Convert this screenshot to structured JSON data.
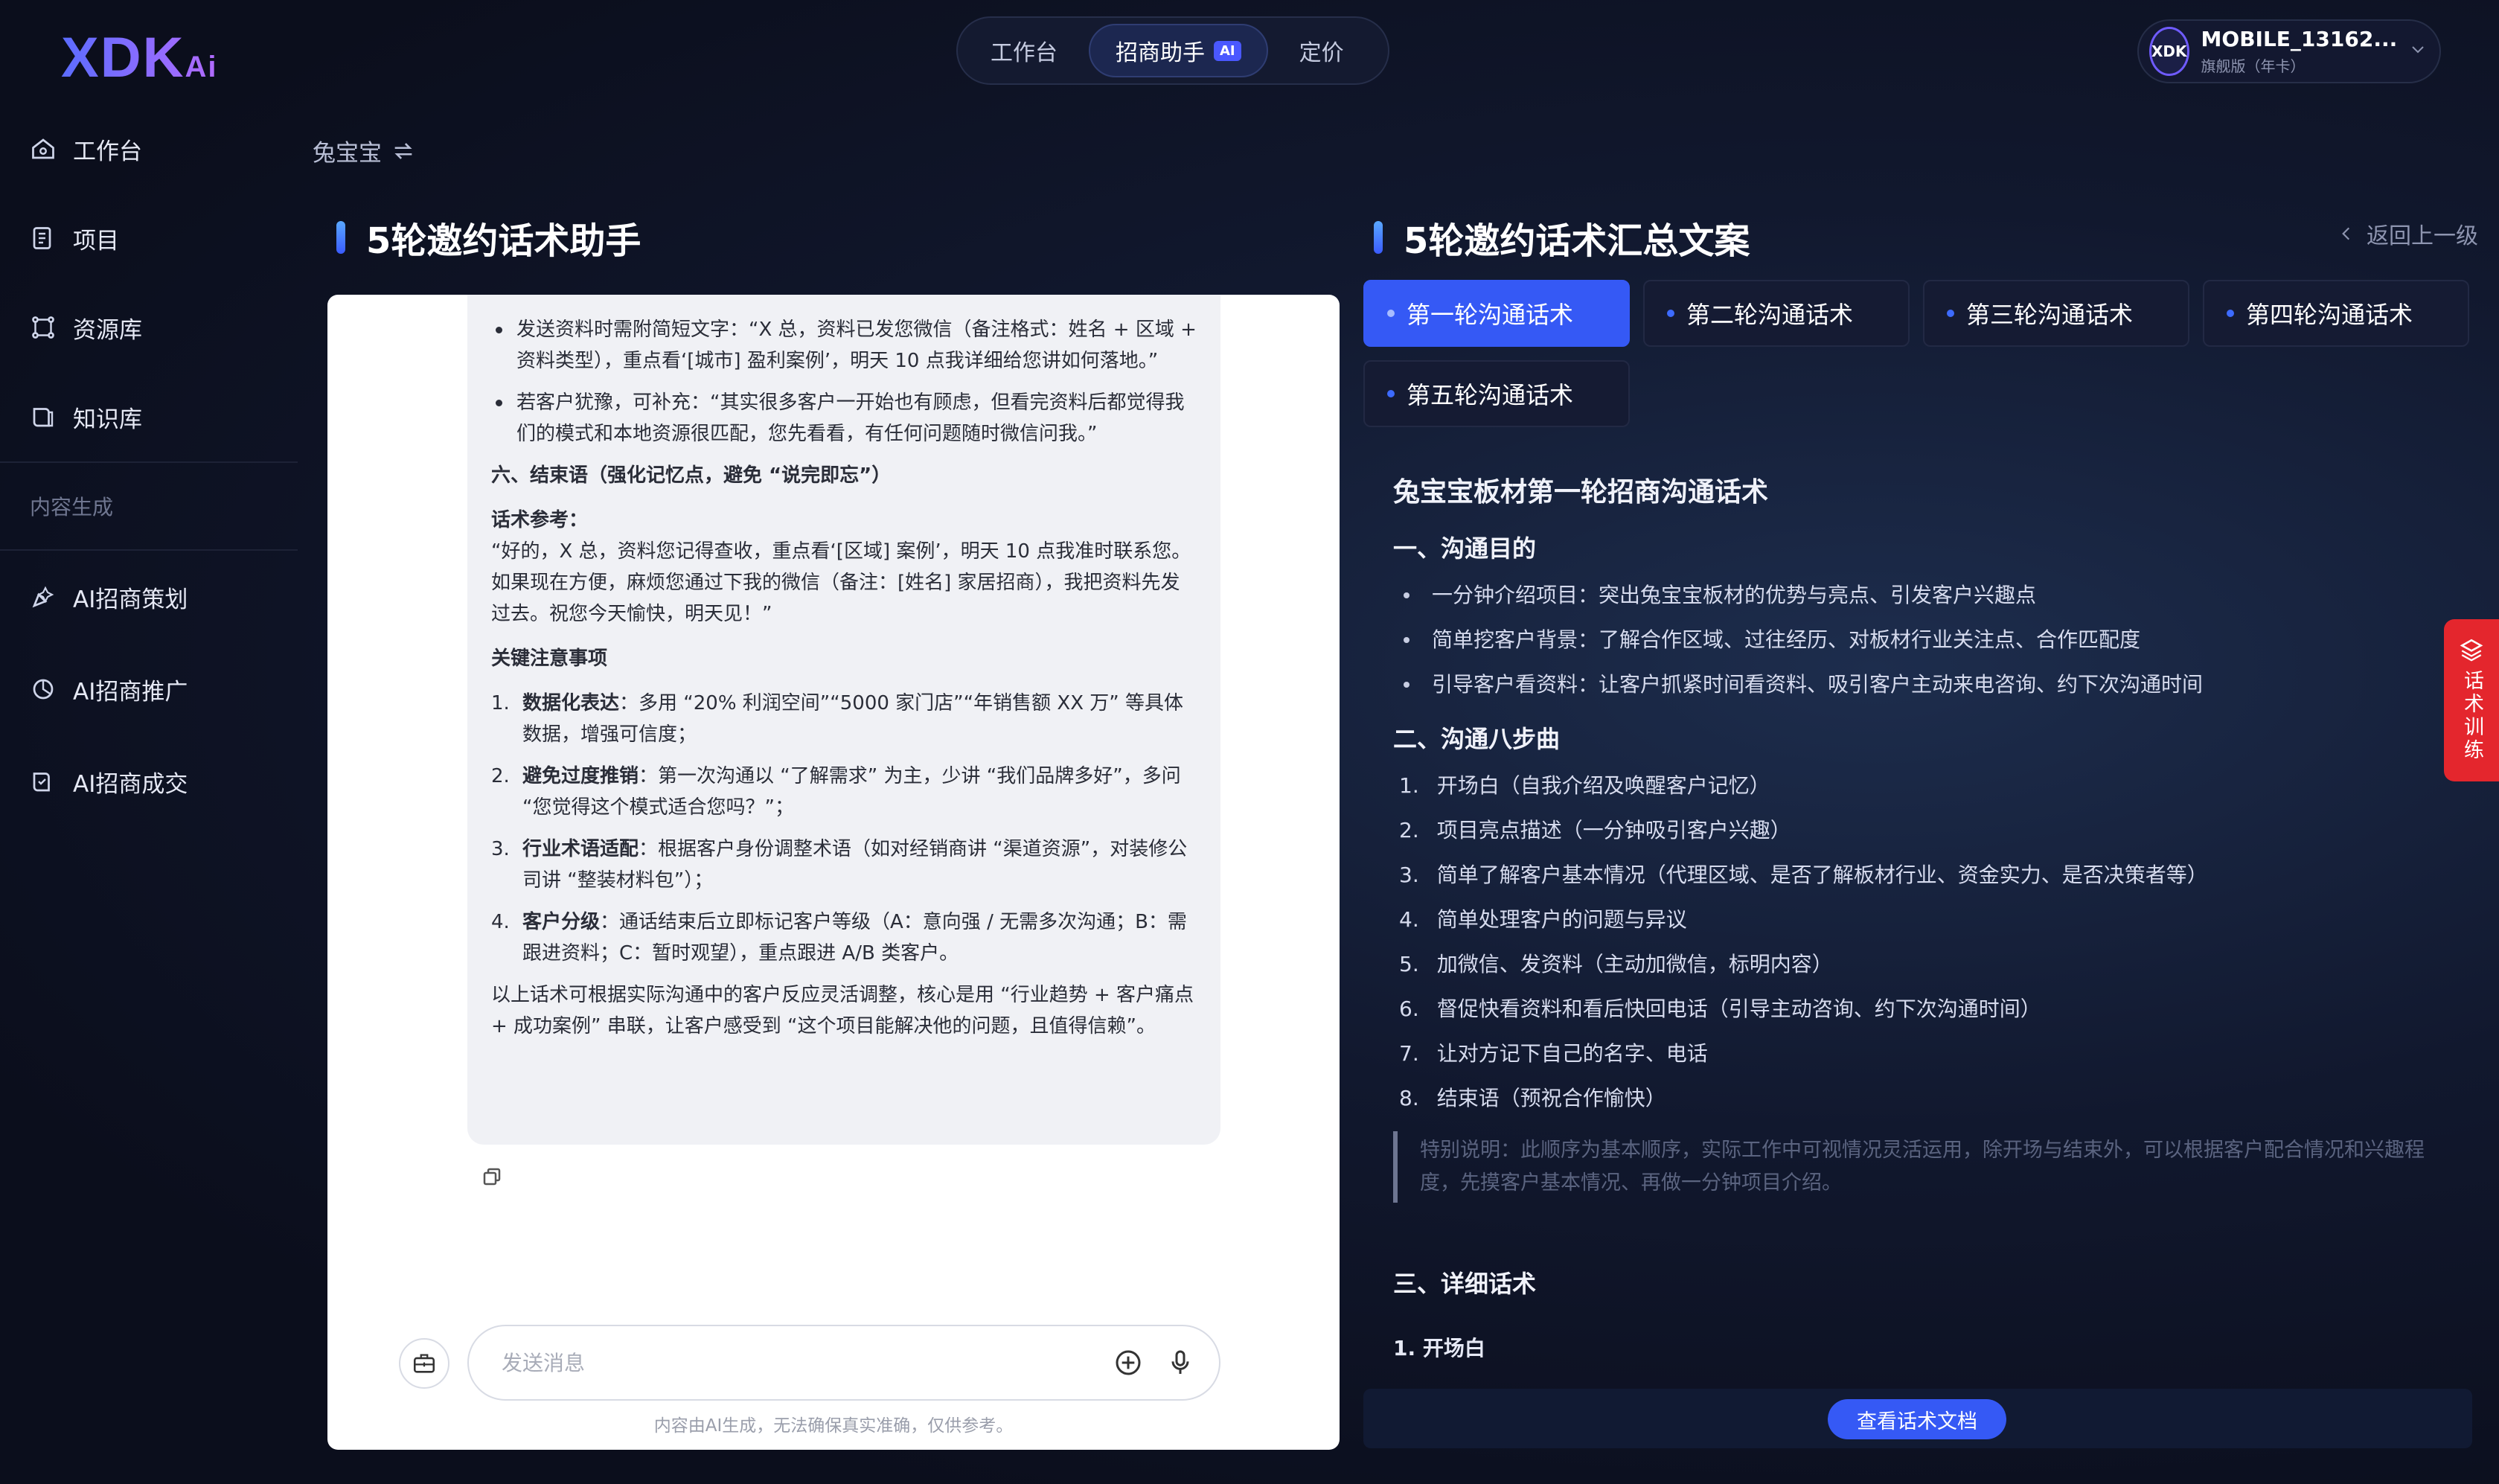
{
  "brand": {
    "logo": "XDK",
    "logo_suffix": "Ai"
  },
  "topnav": {
    "tabs": [
      {
        "label": "工作台"
      },
      {
        "label": "招商助手",
        "badge": "AI"
      },
      {
        "label": "定价"
      }
    ]
  },
  "user": {
    "avatar": "XDK",
    "name": "MOBILE_13162...",
    "plan": "旗舰版（年卡）"
  },
  "sidebar": {
    "items": [
      {
        "label": "工作台",
        "icon": "home-icon"
      },
      {
        "label": "项目",
        "icon": "project-icon"
      },
      {
        "label": "资源库",
        "icon": "resource-icon"
      },
      {
        "label": "知识库",
        "icon": "knowledge-icon"
      }
    ],
    "section": "内容生成",
    "ai_items": [
      {
        "label": "AI招商策划"
      },
      {
        "label": "AI招商推广"
      },
      {
        "label": "AI招商成交"
      }
    ]
  },
  "breadcrumb": {
    "label": "兔宝宝"
  },
  "left_panel": {
    "title": "5轮邀约话术助手"
  },
  "chat": {
    "bullets": [
      "发送资料时需附简短文字：“X 总，资料已发您微信（备注格式：姓名 + 区域 + 资料类型），重点看‘[城市] 盈利案例’，明天 10 点我详细给您讲如何落地。”",
      "若客户犹豫，可补充：“其实很多客户一开始也有顾虑，但看完资料后都觉得我们的模式和本地资源很匹配，您先看看，有任何问题随时微信问我。”"
    ],
    "section6": "六、结束语（强化记忆点，避免 “说完即忘”）",
    "ref_label": "话术参考：",
    "ref_text": "“好的，X 总，资料您记得查收，重点看‘[区域] 案例’，明天 10 点我准时联系您。如果现在方便，麻烦您通过下我的微信（备注：[姓名] 家居招商），我把资料先发过去。祝您今天愉快，明天见！”",
    "key_title": "关键注意事项",
    "key_items": [
      {
        "n": "1.",
        "bold": "数据化表达",
        "text": "：多用 “20% 利润空间”“5000 家门店”“年销售额 XX 万” 等具体数据，增强可信度；"
      },
      {
        "n": "2.",
        "bold": "避免过度推销",
        "text": "：第一次沟通以 “了解需求” 为主，少讲 “我们品牌多好”，多问 “您觉得这个模式适合您吗？”；"
      },
      {
        "n": "3.",
        "bold": "行业术语适配",
        "text": "：根据客户身份调整术语（如对经销商讲 “渠道资源”，对装修公司讲 “整装材料包”）；"
      },
      {
        "n": "4.",
        "bold": "客户分级",
        "text": "：通话结束后立即标记客户等级（A：意向强 / 无需多次沟通；B：需跟进资料；C：暂时观望），重点跟进 A/B 类客户。"
      }
    ],
    "summary": "以上话术可根据实际沟通中的客户反应灵活调整，核心是用 “行业趋势 + 客户痛点 + 成功案例” 串联，让客户感受到 “这个项目能解决他的问题，且值得信赖”。",
    "input_placeholder": "发送消息",
    "disclaimer": "内容由AI生成，无法确保真实准确，仅供参考。"
  },
  "right_panel": {
    "title": "5轮邀约话术汇总文案",
    "back": "返回上一级",
    "rounds": [
      "第一轮沟通话术",
      "第二轮沟通话术",
      "第三轮沟通话术",
      "第四轮沟通话术",
      "第五轮沟通话术"
    ],
    "active_round": 0,
    "doc": {
      "title": "兔宝宝板材第一轮招商沟通话术",
      "h_purpose": "一、沟通目的",
      "purpose": [
        "一分钟介绍项目：突出兔宝宝板材的优势与亮点、引发客户兴趣点",
        "简单挖客户背景：了解合作区域、过往经历、对板材行业关注点、合作匹配度",
        "引导客户看资料：让客户抓紧时间看资料、吸引客户主动来电咨询、约下次沟通时间"
      ],
      "h_steps": "二、沟通八步曲",
      "steps": [
        "开场白（自我介绍及唤醒客户记忆）",
        "项目亮点描述（一分钟吸引客户兴趣）",
        "简单了解客户基本情况（代理区域、是否了解板材行业、资金实力、是否决策者等）",
        "简单处理客户的问题与异议",
        "加微信、发资料（主动加微信，标明内容）",
        "督促快看资料和看后快回电话（引导主动咨询、约下次沟通时间）",
        "让对方记下自己的名字、电话",
        "结束语（预祝合作愉快）"
      ],
      "note": "特别说明：此顺序为基本顺序，实际工作中可视情况灵活运用，除开场与结束外，可以根据客户配合情况和兴趣程度，先摸客户基本情况、再做一分钟项目介绍。",
      "h_detail": "三、详细话术",
      "detail_first": "1. 开场白"
    },
    "view_doc": "查看话术文档"
  },
  "float_tab": {
    "label": "话术训练"
  },
  "colors": {
    "accent": "#3559f5",
    "float": "#e4262d",
    "badge": "#4a58ff"
  }
}
